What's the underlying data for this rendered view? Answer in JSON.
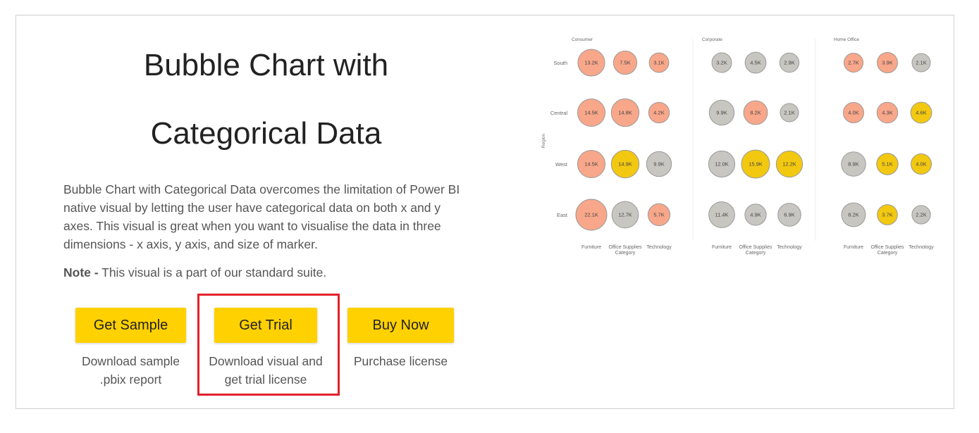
{
  "title_line1": "Bubble Chart with",
  "title_line2": "Categorical Data",
  "description": "Bubble Chart with Categorical Data overcomes the limitation of Power BI native visual by letting the user have categorical data on both x and y axes. This visual is great when you want to visualise the data in three dimensions - x axis, y axis, and size of marker.",
  "note_label": "Note -",
  "note_text": " This visual is a part of our standard suite.",
  "buttons": [
    {
      "label": "Get Sample",
      "caption1": "Download sample",
      "caption2": ".pbix report"
    },
    {
      "label": "Get Trial",
      "caption1": "Download visual and",
      "caption2": "get trial license"
    },
    {
      "label": "Buy Now",
      "caption1": "Purchase license",
      "caption2": ""
    }
  ],
  "highlight_color": "#e3212b",
  "accent_color": "#ffd100",
  "chart_data": {
    "type": "scatter",
    "ylabel": "Region",
    "xlabel": "Category",
    "panels": [
      "Consumer",
      "Corporate",
      "Home Office"
    ],
    "categories": [
      "Furniture",
      "Office Supplies",
      "Technology"
    ],
    "regions": [
      "South",
      "Central",
      "West",
      "East"
    ],
    "colors": {
      "salmon": "#f8a78a",
      "gray": "#c8c6c0",
      "yellow": "#f2c811"
    },
    "bubbles": [
      [
        [
          [
            "13.2K",
            13.2,
            "salmon"
          ],
          [
            "7.5K",
            7.5,
            "salmon"
          ],
          [
            "3.1K",
            3.1,
            "salmon"
          ]
        ],
        [
          [
            "14.5K",
            14.5,
            "salmon"
          ],
          [
            "14.8K",
            14.8,
            "salmon"
          ],
          [
            "4.2K",
            4.2,
            "salmon"
          ]
        ],
        [
          [
            "14.5K",
            14.5,
            "salmon"
          ],
          [
            "14.9K",
            14.9,
            "yellow"
          ],
          [
            "9.9K",
            9.9,
            "gray"
          ]
        ],
        [
          [
            "22.1K",
            22.1,
            "salmon"
          ],
          [
            "12.7K",
            12.7,
            "gray"
          ],
          [
            "5.7K",
            5.7,
            "salmon"
          ]
        ]
      ],
      [
        [
          [
            "3.2K",
            3.2,
            "gray"
          ],
          [
            "4.5K",
            4.5,
            "gray"
          ],
          [
            "2.9K",
            2.9,
            "gray"
          ]
        ],
        [
          [
            "9.9K",
            9.9,
            "gray"
          ],
          [
            "8.2K",
            8.2,
            "salmon"
          ],
          [
            "2.1K",
            2.1,
            "gray"
          ]
        ],
        [
          [
            "12.0K",
            12.0,
            "gray"
          ],
          [
            "15.9K",
            15.9,
            "yellow"
          ],
          [
            "12.2K",
            12.2,
            "yellow"
          ]
        ],
        [
          [
            "11.4K",
            11.4,
            "gray"
          ],
          [
            "4.9K",
            4.9,
            "gray"
          ],
          [
            "6.9K",
            6.9,
            "gray"
          ]
        ]
      ],
      [
        [
          [
            "2.7K",
            2.7,
            "salmon"
          ],
          [
            "3.9K",
            3.9,
            "salmon"
          ],
          [
            "2.1K",
            2.1,
            "gray"
          ]
        ],
        [
          [
            "4.0K",
            4.0,
            "salmon"
          ],
          [
            "4.3K",
            4.3,
            "salmon"
          ],
          [
            "4.6K",
            4.6,
            "yellow"
          ]
        ],
        [
          [
            "8.9K",
            8.9,
            "gray"
          ],
          [
            "5.1K",
            5.1,
            "yellow"
          ],
          [
            "4.0K",
            4.0,
            "yellow"
          ]
        ],
        [
          [
            "8.2K",
            8.2,
            "gray"
          ],
          [
            "3.7K",
            3.7,
            "yellow"
          ],
          [
            "2.2K",
            2.2,
            "gray"
          ]
        ]
      ]
    ]
  }
}
